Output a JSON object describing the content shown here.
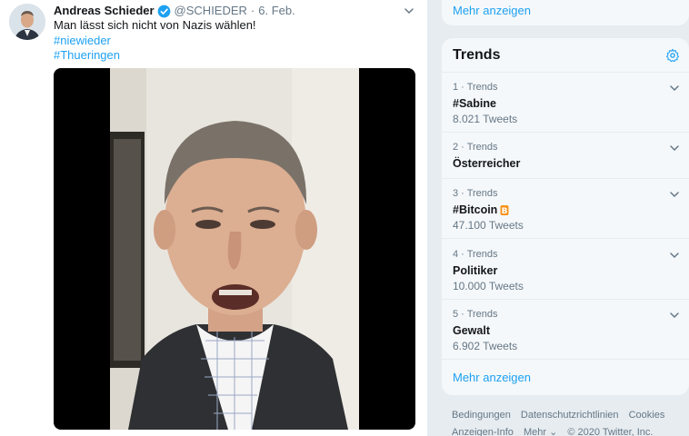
{
  "tweet": {
    "author_name": "Andreas Schieder",
    "handle": "@SCHIEDER",
    "separator": "·",
    "date": "6. Feb.",
    "text": "Man lässt sich nicht von Nazis wählen!",
    "hashtags": [
      "#niewieder",
      "#Thueringen"
    ]
  },
  "sidebar": {
    "top_more_link": "Mehr anzeigen",
    "trends_title": "Trends",
    "trends": [
      {
        "meta": "1 · Trends",
        "name": "#Sabine",
        "count": "8.021 Tweets"
      },
      {
        "meta": "2 · Trends",
        "name": "Österreicher",
        "count": ""
      },
      {
        "meta": "3 · Trends",
        "name": "#Bitcoin",
        "count": "47.100 Tweets",
        "icon": "bitcoin-icon"
      },
      {
        "meta": "4 · Trends",
        "name": "Politiker",
        "count": "10.000 Tweets"
      },
      {
        "meta": "5 · Trends",
        "name": "Gewalt",
        "count": "6.902 Tweets"
      }
    ],
    "trends_more_link": "Mehr anzeigen"
  },
  "footer": {
    "links_row1": [
      "Bedingungen",
      "Datenschutzrichtlinien",
      "Cookies"
    ],
    "links_row2": [
      "Anzeigen-Info",
      "Mehr ⌄",
      "© 2020 Twitter, Inc."
    ]
  },
  "colors": {
    "link": "#1da1f2",
    "secondary_text": "#657786",
    "card_background": "#f5f8fa",
    "page_background": "#e6ecf0"
  }
}
